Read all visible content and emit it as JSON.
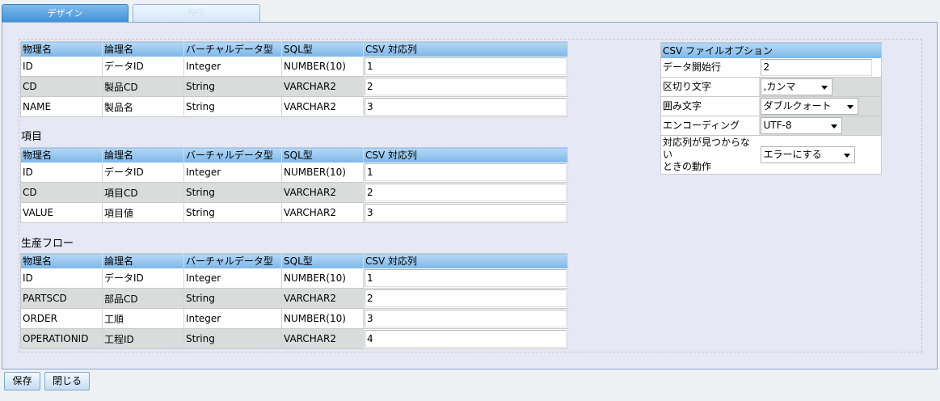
{
  "tabs": [
    {
      "label": "デザイン",
      "active": true
    },
    {
      "label": "情報",
      "active": false
    }
  ],
  "columns": [
    "物理名",
    "論理名",
    "バーチャルデータ型",
    "SQL型",
    "CSV 対応列"
  ],
  "tables": [
    {
      "title": "",
      "rows": [
        [
          "ID",
          "データID",
          "Integer",
          "NUMBER(10)",
          "1"
        ],
        [
          "CD",
          "製品CD",
          "String",
          "VARCHAR2",
          "2"
        ],
        [
          "NAME",
          "製品名",
          "String",
          "VARCHAR2",
          "3"
        ]
      ]
    },
    {
      "title": "項目",
      "rows": [
        [
          "ID",
          "データID",
          "Integer",
          "NUMBER(10)",
          "1"
        ],
        [
          "CD",
          "項目CD",
          "String",
          "VARCHAR2",
          "2"
        ],
        [
          "VALUE",
          "項目値",
          "String",
          "VARCHAR2",
          "3"
        ]
      ]
    },
    {
      "title": "生産フロー",
      "rows": [
        [
          "ID",
          "データID",
          "Integer",
          "NUMBER(10)",
          "1"
        ],
        [
          "PARTSCD",
          "部品CD",
          "String",
          "VARCHAR2",
          "2"
        ],
        [
          "ORDER",
          "工順",
          "Integer",
          "NUMBER(10)",
          "3"
        ],
        [
          "OPERATIONID",
          "工程ID",
          "String",
          "VARCHAR2",
          "4"
        ]
      ]
    }
  ],
  "csv_options": {
    "header": "CSV ファイルオプション",
    "start_row_label": "データ開始行",
    "start_row_value": "2",
    "delimiter_label": "区切り文字",
    "delimiter_value": ",カンマ",
    "quote_label": "囲み文字",
    "quote_value": "ダブルクォート",
    "encoding_label": "エンコーディング",
    "encoding_value": "UTF-8",
    "missing_label_line1": "対応列が見つからない",
    "missing_label_line2": "ときの動作",
    "missing_value": "エラーにする"
  },
  "buttons": {
    "save": "保存",
    "close": "閉じる"
  },
  "colors": {
    "tab_active": "#3d8fd6",
    "header_blue": "#7db6e8",
    "panel_bg": "#e6e8f5",
    "row_alt": "#dadbdb"
  }
}
